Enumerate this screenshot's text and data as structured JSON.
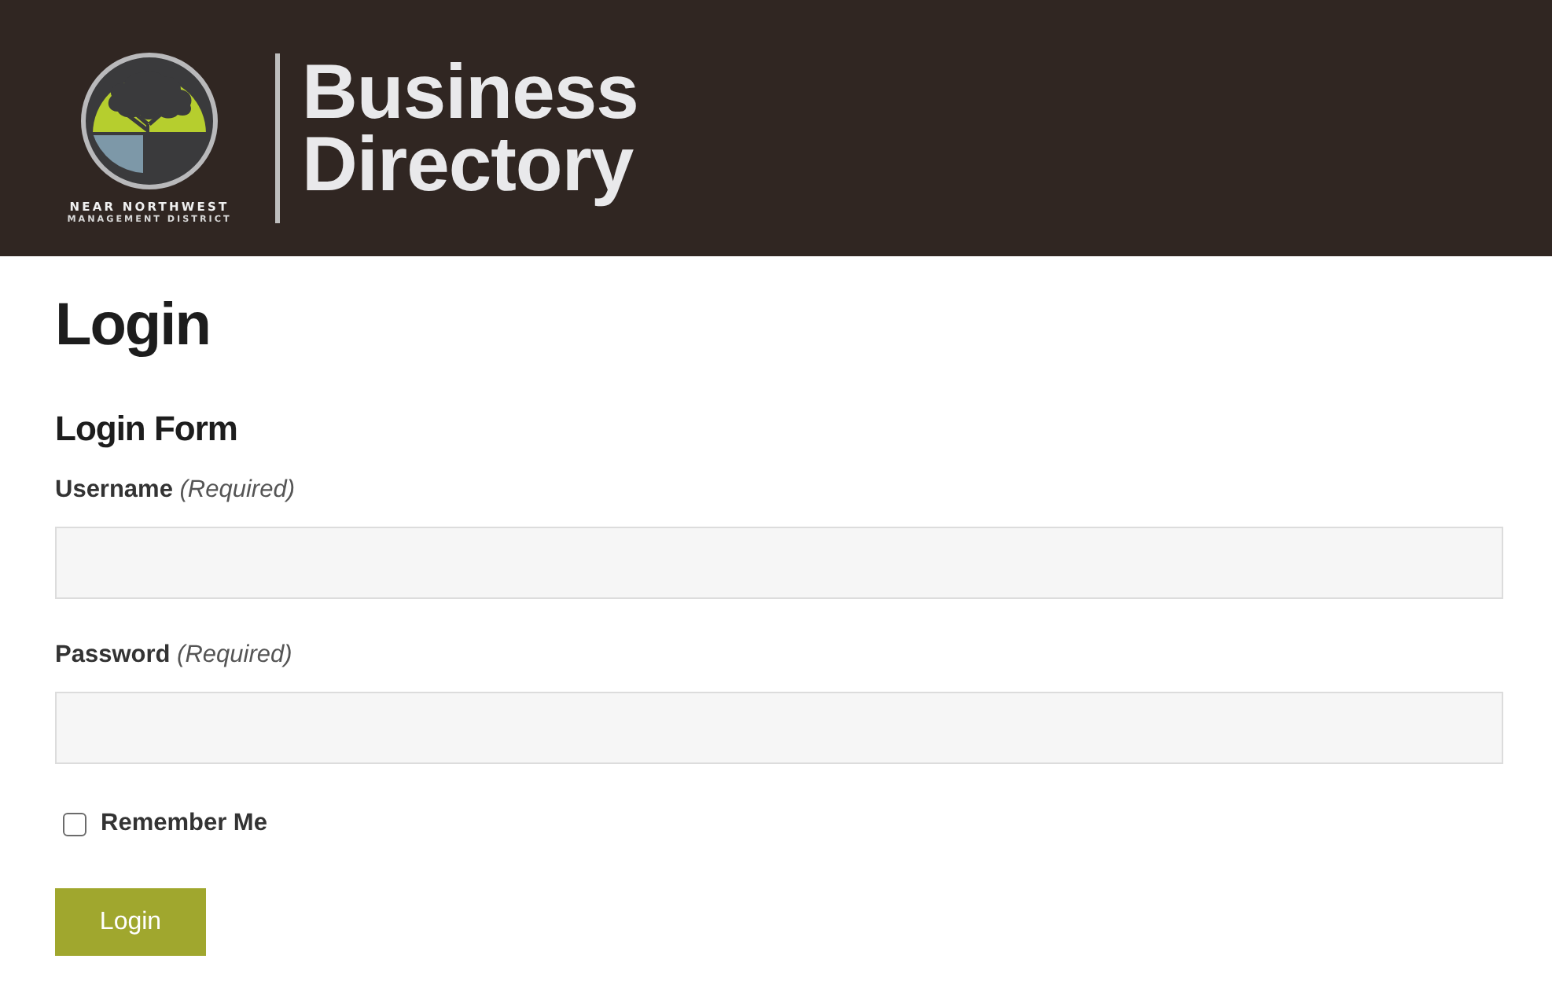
{
  "header": {
    "logo": {
      "line_1": "NEAR NORTHWEST",
      "line_2": "MANAGEMENT DISTRICT"
    },
    "title_lines": [
      "Business",
      "Directory"
    ]
  },
  "page_title": "Login",
  "form": {
    "title": "Login Form",
    "fields": [
      {
        "label": "Username *(Required)*"
      },
      {
        "label": "Password *(Required)*"
      }
    ],
    "remember": {
      "label": "Remember Me",
      "checked": false
    },
    "submit": "Login"
  }
}
